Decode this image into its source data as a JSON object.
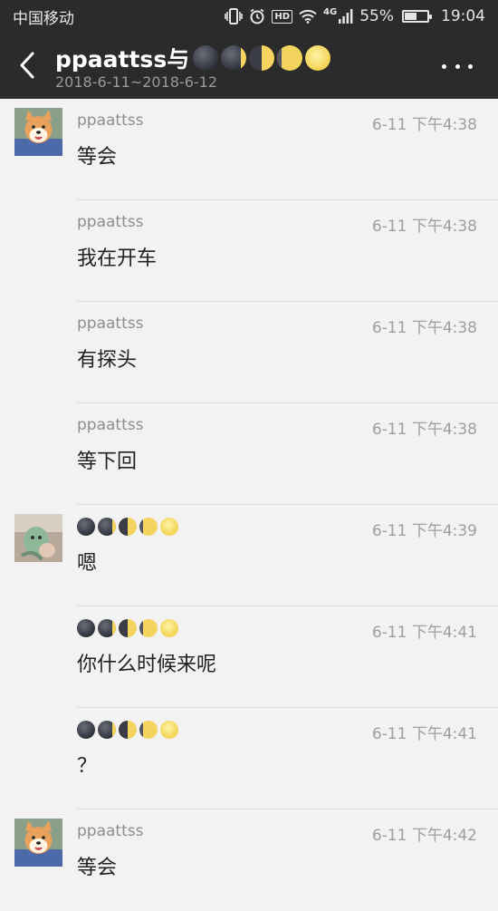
{
  "status_bar": {
    "carrier": "中国移动",
    "network": "4G",
    "hd": "HD",
    "battery_percent": "55%",
    "battery_level": 0.55,
    "time": "19:04"
  },
  "header": {
    "title_name": "ppaattss与",
    "date_range": "2018-6-11~2018-6-12",
    "back_icon": "chevron-left-icon",
    "more_icon": "more-horizontal-icon"
  },
  "messages": [
    {
      "sender": "ppaattss",
      "time": "6-11 下午4:38",
      "text": "等会",
      "avatar": "shiba-dog-avatar",
      "show_avatar": true
    },
    {
      "sender": "ppaattss",
      "time": "6-11 下午4:38",
      "text": "我在开车",
      "show_avatar": false
    },
    {
      "sender": "ppaattss",
      "time": "6-11 下午4:38",
      "text": "有探头",
      "show_avatar": false
    },
    {
      "sender": "ppaattss",
      "time": "6-11 下午4:38",
      "text": "等下回",
      "show_avatar": false
    },
    {
      "sender": "moon-emoji-name",
      "time": "6-11 下午4:39",
      "text": "嗯",
      "avatar": "plush-toy-avatar",
      "show_avatar": true
    },
    {
      "sender": "moon-emoji-name",
      "time": "6-11 下午4:41",
      "text": "你什么时候来呢",
      "show_avatar": false
    },
    {
      "sender": "moon-emoji-name",
      "time": "6-11 下午4:41",
      "text": "？",
      "show_avatar": false
    },
    {
      "sender": "ppaattss",
      "time": "6-11 下午4:42",
      "text": "等会",
      "avatar": "shiba-dog-avatar",
      "show_avatar": true
    }
  ],
  "colors": {
    "bar_bg": "#2b2b2b",
    "chat_bg": "#f2f2f2",
    "divider": "#dcdcdc"
  }
}
